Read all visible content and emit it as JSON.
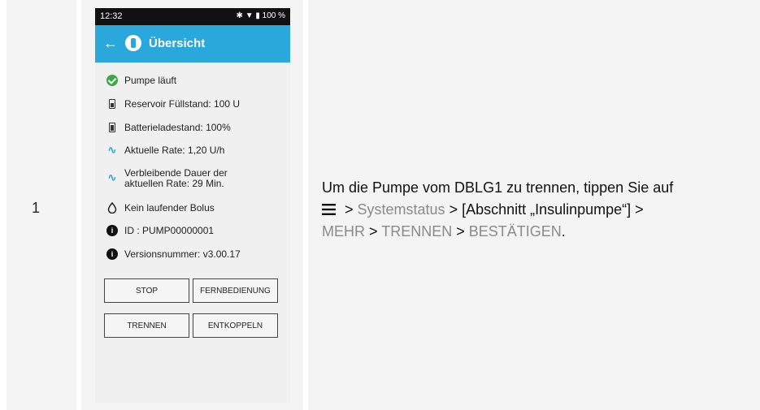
{
  "step_number": "1",
  "phone": {
    "status_bar": {
      "time": "12:32",
      "right": "✱ ▼ ▮ 100 %"
    },
    "app_bar": {
      "title": "Übersicht",
      "back_icon": "arrow-left-icon",
      "logo_icon": "app-logo-icon"
    },
    "status_items": [
      {
        "icon": "check-circle-icon",
        "text": "Pumpe läuft"
      },
      {
        "icon": "reservoir-icon",
        "text": "Reservoir Füllstand: 100 U"
      },
      {
        "icon": "battery-icon",
        "text": "Batterieladestand: 100%"
      },
      {
        "icon": "rate-wave-icon",
        "text": "Aktuelle Rate: 1,20 U/h"
      },
      {
        "icon": "rate-wave-icon",
        "text": "Verbleibende Dauer der aktuellen Rate: 29 Min."
      },
      {
        "icon": "drop-icon",
        "text": "Kein laufender Bolus"
      },
      {
        "icon": "info-icon",
        "text": "ID : PUMP00000001"
      },
      {
        "icon": "info-icon",
        "text": "Versionsnummer: v3.00.17"
      }
    ],
    "buttons": {
      "stop": "STOP",
      "remote": "FERNBEDIENUNG",
      "disconnect": "TRENNEN",
      "unpair": "ENTKOPPELN"
    }
  },
  "instruction": {
    "part1": "Um die Pumpe vom DBLG1 zu trennen, tippen Sie auf",
    "sep1": " > ",
    "systemstatus": "Systemstatus",
    "sep2": " > [Abschnitt „Insulinpumpe“] >",
    "mehr": "MEHR",
    "sep3": " > ",
    "trennen": "TRENNEN",
    "sep4": " > ",
    "bestaetigen": "BESTÄTIGEN",
    "end": ".",
    "menu_icon": "hamburger-menu-icon"
  }
}
